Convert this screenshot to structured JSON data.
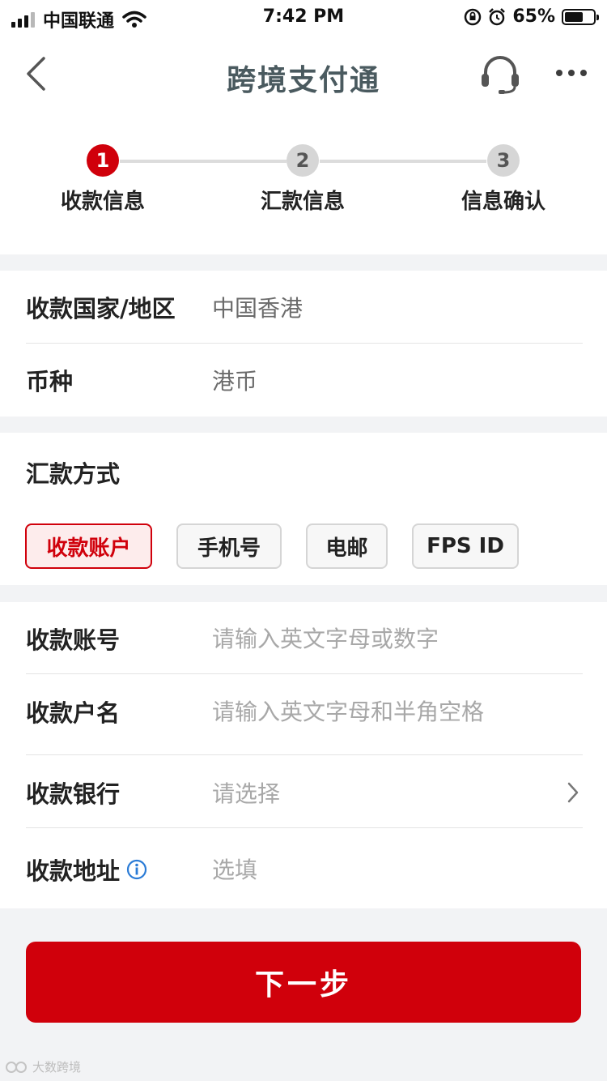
{
  "status_bar": {
    "carrier": "中国联通",
    "time": "7:42 PM",
    "battery_percent": "65%",
    "battery_level": 0.65
  },
  "navbar": {
    "title": "跨境支付通",
    "icons": [
      "chevron-left-icon",
      "headset-icon",
      "more-icon"
    ]
  },
  "steps": [
    {
      "number": "1",
      "label": "收款信息",
      "active": true
    },
    {
      "number": "2",
      "label": "汇款信息",
      "active": false
    },
    {
      "number": "3",
      "label": "信息确认",
      "active": false
    }
  ],
  "region": {
    "country_label": "收款国家/地区",
    "country_value": "中国香港",
    "currency_label": "币种",
    "currency_value": "港币"
  },
  "method": {
    "title": "汇款方式",
    "options": [
      "收款账户",
      "手机号",
      "电邮",
      "FPS ID"
    ],
    "selected": "收款账户"
  },
  "form": {
    "account_label": "收款账号",
    "account_placeholder": "请输入英文字母或数字",
    "name_label": "收款户名",
    "name_placeholder": "请输入英文字母和半角空格",
    "bank_label": "收款银行",
    "bank_placeholder": "请选择",
    "address_label": "收款地址",
    "address_placeholder": "选填"
  },
  "next_button": "下一步",
  "watermark": "大数跨境",
  "colors": {
    "accent": "#d0000b",
    "title": "#4a5a5f",
    "info_icon": "#2a7bd6"
  }
}
